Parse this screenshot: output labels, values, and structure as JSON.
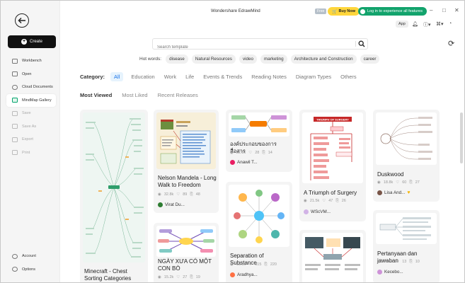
{
  "window": {
    "title": "Wondershare EdrawMind",
    "badge": "Free",
    "buy_now": "Buy Now",
    "login": "Log in to experience all features",
    "app_chip": "App"
  },
  "sidebar": {
    "create": "Create",
    "items": [
      {
        "label": "Workbench"
      },
      {
        "label": "Open"
      },
      {
        "label": "Cloud Documents"
      },
      {
        "label": "MindMap Gallery"
      },
      {
        "label": "Save"
      },
      {
        "label": "Save As"
      },
      {
        "label": "Export"
      },
      {
        "label": "Print"
      }
    ],
    "bottom": [
      {
        "label": "Account"
      },
      {
        "label": "Options"
      }
    ]
  },
  "search": {
    "placeholder": "Search template"
  },
  "hot_words": {
    "label": "Hot words:",
    "items": [
      "disease",
      "Natural Resources",
      "video",
      "marketing",
      "Architecture and Construction",
      "career"
    ]
  },
  "category": {
    "label": "Category:",
    "items": [
      "All",
      "Education",
      "Work",
      "Life",
      "Events & Trends",
      "Reading Notes",
      "Diagram Types",
      "Others"
    ]
  },
  "sort": {
    "items": [
      "Most Viewed",
      "Most Liked",
      "Recent Releases"
    ]
  },
  "cards": [
    {
      "title": "Minecraft - Chest Sorting Categories",
      "views": "",
      "likes": "",
      "copies": "",
      "author": ""
    },
    {
      "title": "Nelson Mandela - Long Walk to Freedom",
      "views": "32.8k",
      "likes": "89",
      "copies": "48",
      "author": "Virat Du..."
    },
    {
      "title": "NGÀY XƯA CÓ MỘT CON BÒ",
      "views": "15.2k",
      "likes": "27",
      "copies": "19",
      "author": ""
    },
    {
      "title": "องค์ประกอบของการสื่อสาร",
      "views": "22.8k",
      "likes": "28",
      "copies": "14",
      "author": "Anawil T..."
    },
    {
      "title": "Separation of Substance",
      "views": "18.0k",
      "likes": "315",
      "copies": "220",
      "author": "Aradhya..."
    },
    {
      "title": "A Triumph of Surgery",
      "views": "21.5k",
      "likes": "47",
      "copies": "26",
      "author": "WScVM..."
    },
    {
      "title": "Duskwood",
      "views": "18.8k",
      "likes": "60",
      "copies": "27",
      "author": "Lisa And..."
    },
    {
      "title": "Pertanyaan dan jawaban",
      "views": "19.0k",
      "likes": "13",
      "copies": "10",
      "author": "Kecebo..."
    }
  ],
  "thumb_texts": {
    "triumph": "TRIUMPH OF SURGERY"
  },
  "colors": {
    "accent": "#1a73e8",
    "brand_green": "#12a36c",
    "buy_yellow": "#ffd63b",
    "create_bg": "#111111"
  }
}
